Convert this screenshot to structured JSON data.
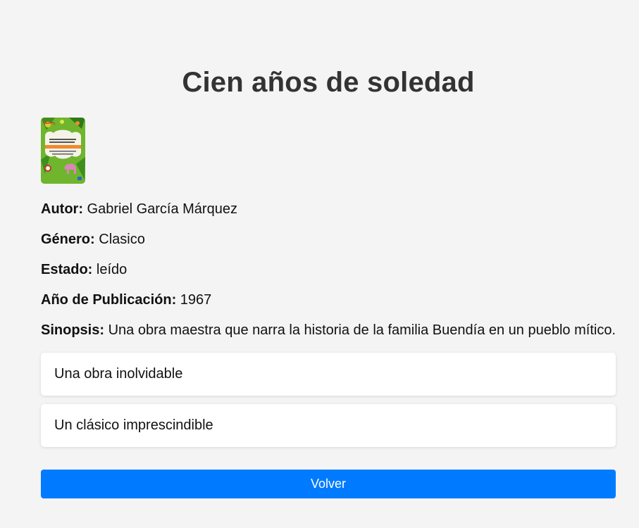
{
  "book": {
    "title": "Cien años de soledad",
    "cover_lettering": "GABRIEL GARCÍA MÁRQUEZ ONE HUNDRED YEARS OF SOLITUDE"
  },
  "fields": {
    "autor": {
      "label": "Autor:",
      "value": " Gabriel García Márquez"
    },
    "genero": {
      "label": "Género:",
      "value": " Clasico"
    },
    "estado": {
      "label": "Estado:",
      "value": " leído"
    },
    "anio": {
      "label": "Año de Publicación:",
      "value": " 1967"
    },
    "sinopsis": {
      "label": "Sinopsis:",
      "value": " Una obra maestra que narra la historia de la familia Buendía en un pueblo mítico."
    }
  },
  "reviews": [
    {
      "text": "Una obra inolvidable"
    },
    {
      "text": "Un clásico imprescindible"
    }
  ],
  "actions": {
    "back_label": "Volver"
  },
  "colors": {
    "background": "#f4f4f4",
    "primary": "#007bff",
    "card": "#ffffff",
    "title": "#333333"
  }
}
